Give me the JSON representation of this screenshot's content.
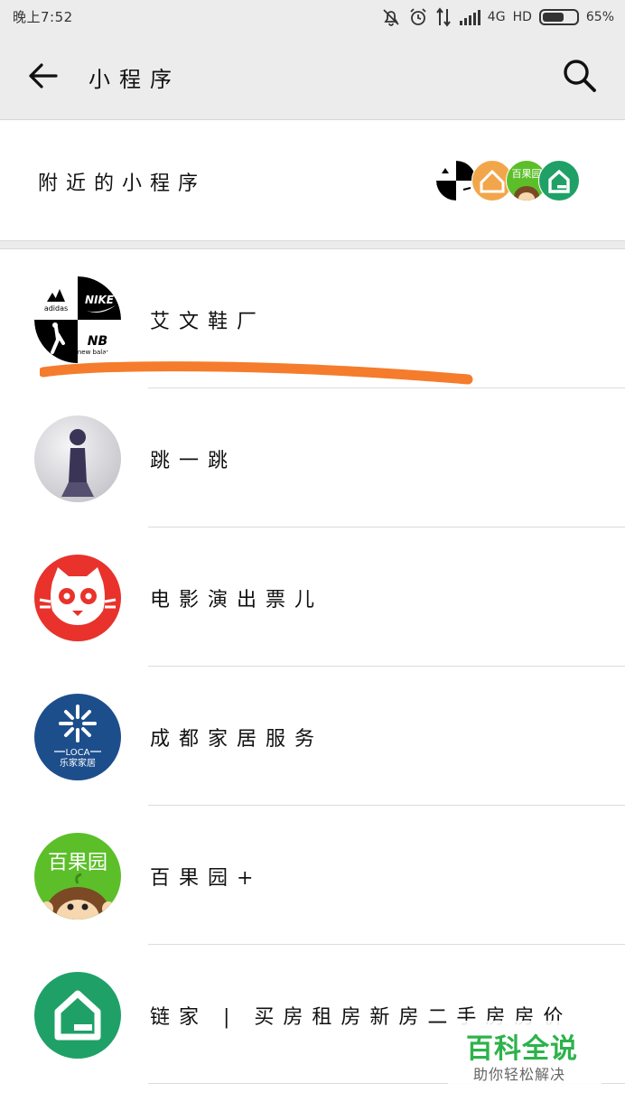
{
  "status_bar": {
    "time": "晚上7:52",
    "network": "4G",
    "hd": "HD",
    "battery": "65%",
    "battery_level": 0.65
  },
  "header": {
    "title": "小程序",
    "back_icon": "back-arrow-icon",
    "search_icon": "search-icon"
  },
  "nearby": {
    "label": "附近的小程序",
    "icon_text_baiguoyuan": "百果园"
  },
  "list": [
    {
      "label": "艾文鞋厂",
      "avatar": "sneaker-brands-logo",
      "logo_texts": [
        "adidas",
        "NIKE",
        "new balance"
      ]
    },
    {
      "label": "跳一跳",
      "avatar": "jump-game-logo"
    },
    {
      "label": "电影演出票儿",
      "avatar": "maoyan-cat-logo"
    },
    {
      "label": "成都家居服务",
      "avatar": "loca-home-logo",
      "logo_texts": [
        "LOCA",
        "乐家家居"
      ]
    },
    {
      "label": "百果园+",
      "avatar": "baiguoyuan-logo",
      "logo_texts": [
        "百果园"
      ]
    },
    {
      "label": "链家 | 买房租房新房二手房房价",
      "avatar": "lianjia-house-logo"
    }
  ],
  "watermark": {
    "title": "百科全说",
    "subtitle": "助你轻松解决"
  },
  "colors": {
    "header_bg": "#ececec",
    "highlight": "#f47c2c",
    "maoyan_red": "#e8322b",
    "loca_blue": "#1d4e8c",
    "baiguoyuan_green": "#5cbf2a",
    "lianjia_green": "#1fa067",
    "watermark_green": "#2cb34a"
  }
}
